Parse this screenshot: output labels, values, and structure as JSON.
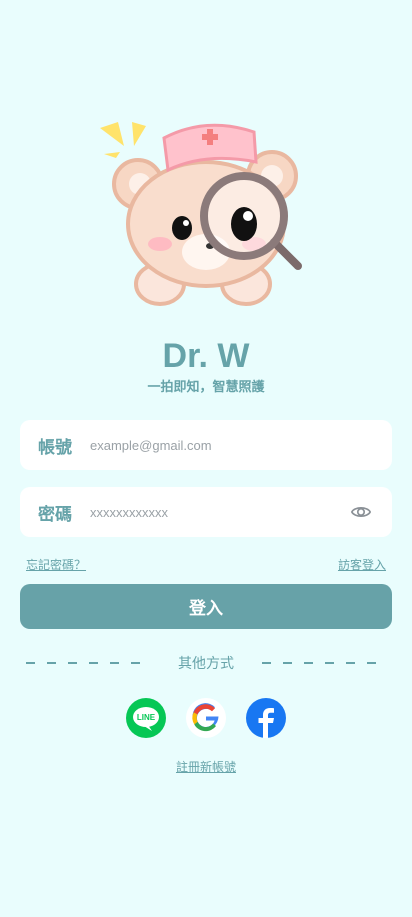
{
  "app": {
    "title": "Dr. W",
    "tagline": "一拍即知，智慧照護"
  },
  "form": {
    "account_label": "帳號",
    "account_placeholder": "example@gmail.com",
    "password_label": "密碼",
    "password_placeholder": "xxxxxxxxxxxx"
  },
  "links": {
    "forgot_password": "忘記密碼？",
    "guest_login": "訪客登入",
    "register": "註冊新帳號"
  },
  "buttons": {
    "login": "登入"
  },
  "divider": {
    "label": "其他方式"
  },
  "social": [
    {
      "name": "line",
      "icon": "line-icon",
      "text": "LINE",
      "color": "#06c755"
    },
    {
      "name": "google",
      "icon": "google-icon",
      "text": "G"
    },
    {
      "name": "facebook",
      "icon": "facebook-icon",
      "text": "f",
      "color": "#1877f2"
    }
  ],
  "theme": {
    "background": "#e9fdfd",
    "accent": "#67a2a8"
  }
}
